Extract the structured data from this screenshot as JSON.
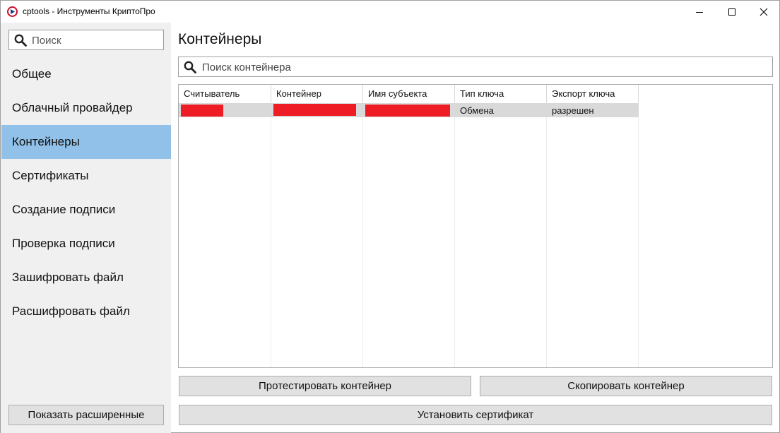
{
  "window": {
    "title": "cptools - Инструменты КриптоПро",
    "controls": [
      "minimize-icon",
      "maximize-icon",
      "close-icon"
    ]
  },
  "sidebar": {
    "search_placeholder": "Поиск",
    "items": [
      {
        "label": "Общее",
        "active": false
      },
      {
        "label": "Облачный провайдер",
        "active": false
      },
      {
        "label": "Контейнеры",
        "active": true
      },
      {
        "label": "Сертификаты",
        "active": false
      },
      {
        "label": "Создание подписи",
        "active": false
      },
      {
        "label": "Проверка подписи",
        "active": false
      },
      {
        "label": "Зашифровать файл",
        "active": false
      },
      {
        "label": "Расшифровать файл",
        "active": false
      }
    ],
    "advanced_button": "Показать расширенные"
  },
  "main": {
    "title": "Контейнеры",
    "search_placeholder": "Поиск контейнера",
    "table": {
      "columns": [
        "Считыватель",
        "Контейнер",
        "Имя субъекта",
        "Тип ключа",
        "Экспорт ключа"
      ],
      "rows": [
        {
          "reader": "",
          "container": "",
          "subject": "",
          "key_type": "Обмена",
          "key_export": "разрешен"
        }
      ],
      "redacted_cells": [
        "reader",
        "container",
        "subject"
      ]
    },
    "buttons": {
      "test": "Протестировать контейнер",
      "copy": "Скопировать контейнер",
      "install": "Установить сертификат"
    }
  },
  "colors": {
    "accent_selected": "#91c1e8",
    "redaction": "#ee1c25",
    "sidebar_bg": "#f0f0f0",
    "button_bg": "#e1e1e1",
    "row_selected": "#d9d9d9"
  }
}
